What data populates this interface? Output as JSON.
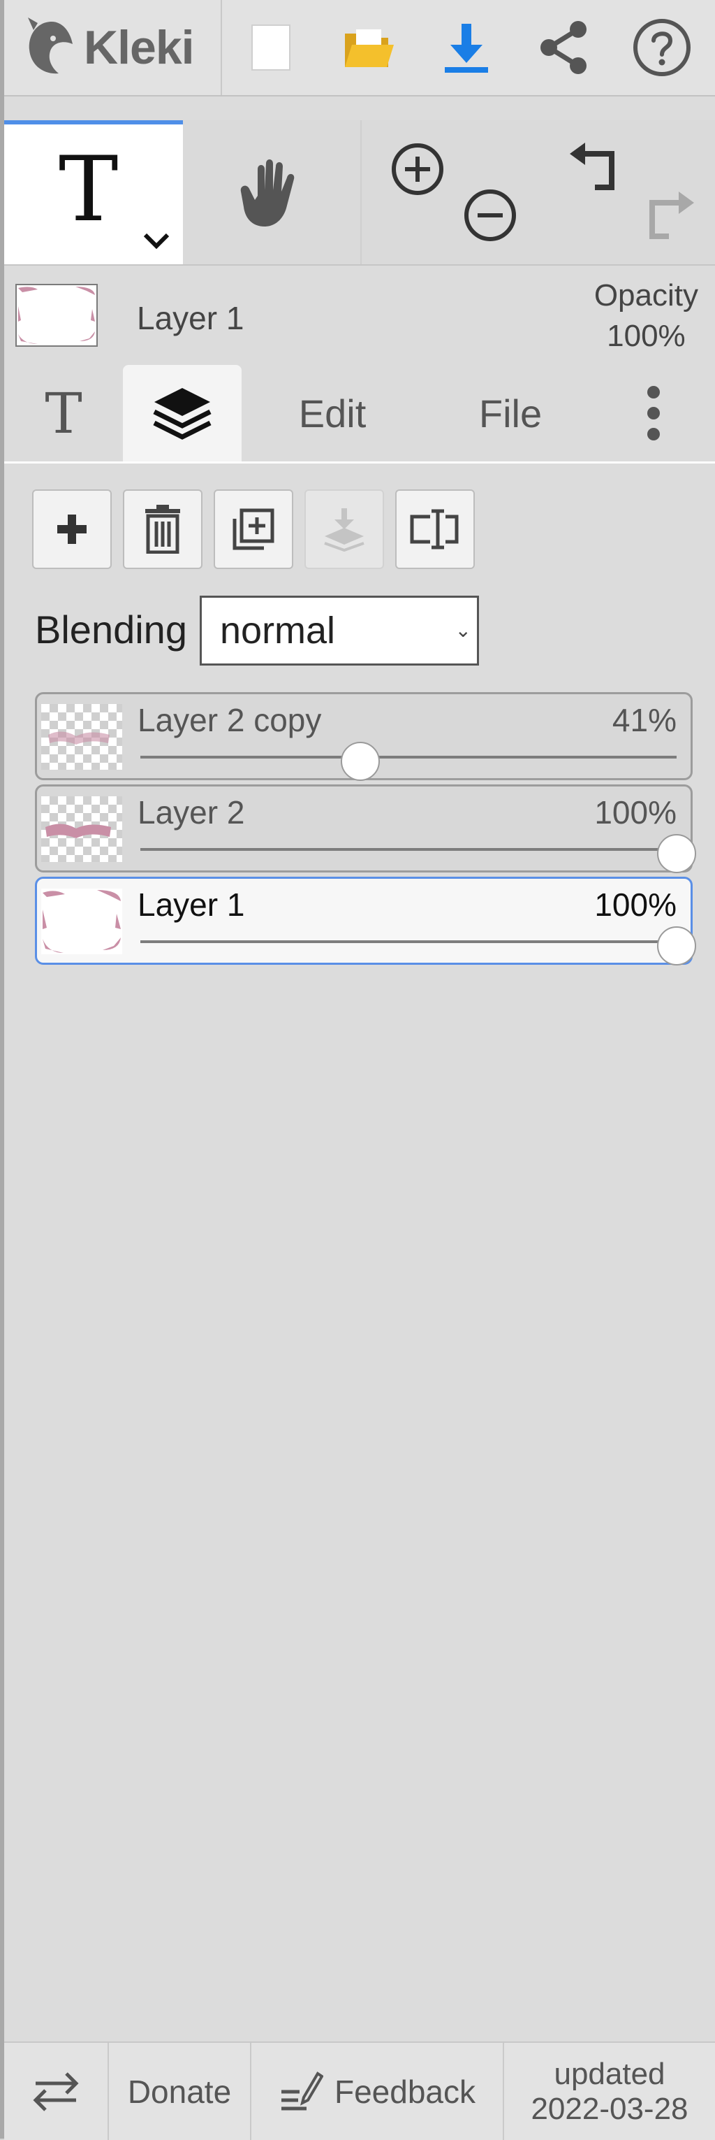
{
  "app": {
    "logo_text": "Kleki"
  },
  "top_toolbar": {
    "icons": [
      "new-image-icon",
      "open-folder-icon",
      "download-icon",
      "share-icon",
      "help-icon"
    ],
    "accent_colors": {
      "folder": "#f4c02c",
      "download": "#1a7ee6"
    }
  },
  "tools": {
    "active": "text-tool",
    "text_tool_glyph": "T",
    "icons": [
      "text-tool-icon",
      "hand-tool-icon",
      "zoom-in-icon",
      "zoom-out-icon",
      "undo-icon",
      "redo-icon"
    ]
  },
  "current_layer": {
    "name": "Layer 1",
    "opacity_label": "Opacity",
    "opacity_value": "100%"
  },
  "tabs": [
    {
      "label": "T",
      "icon": "text-tab-icon"
    },
    {
      "label": "",
      "icon": "layers-tab-icon",
      "active": true
    },
    {
      "label": "Edit"
    },
    {
      "label": "File"
    },
    {
      "label": "",
      "icon": "more-vertical-icon"
    }
  ],
  "layer_actions": {
    "icons": [
      "add-layer-icon",
      "delete-layer-icon",
      "duplicate-layer-icon",
      "merge-down-icon",
      "rename-layer-icon"
    ],
    "merge_down_disabled": true
  },
  "blending": {
    "label": "Blending",
    "value": "normal"
  },
  "layers": [
    {
      "name": "Layer 2 copy",
      "opacity": "41%",
      "opacity_fraction": 0.41,
      "selected": false
    },
    {
      "name": "Layer 2",
      "opacity": "100%",
      "opacity_fraction": 1.0,
      "selected": false
    },
    {
      "name": "Layer 1",
      "opacity": "100%",
      "opacity_fraction": 1.0,
      "selected": true
    }
  ],
  "bottom_bar": {
    "donate": "Donate",
    "feedback": "Feedback",
    "updated_label": "updated",
    "updated_date": "2022-03-28"
  }
}
